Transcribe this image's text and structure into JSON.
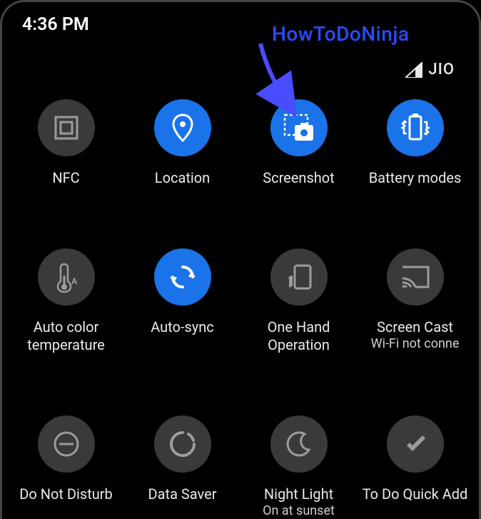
{
  "status": {
    "time": "4:36 PM",
    "carrier": "JIO"
  },
  "annotation": {
    "watermark": "HowToDoNinja"
  },
  "colors": {
    "active": "#1a73e8",
    "inactive": "#3a3a3a",
    "accent_annotation": "#2a4cff"
  },
  "tiles": [
    {
      "id": "nfc",
      "label": "NFC",
      "sublabel": "",
      "active": false,
      "icon": "nfc-icon"
    },
    {
      "id": "location",
      "label": "Location",
      "sublabel": "",
      "active": true,
      "icon": "location-icon"
    },
    {
      "id": "screenshot",
      "label": "Screenshot",
      "sublabel": "",
      "active": true,
      "icon": "screenshot-icon"
    },
    {
      "id": "battery",
      "label": "Battery modes",
      "sublabel": "",
      "active": true,
      "icon": "battery-icon"
    },
    {
      "id": "autocolor",
      "label": "Auto color temperature",
      "sublabel": "",
      "active": false,
      "icon": "thermometer-icon"
    },
    {
      "id": "autosync",
      "label": "Auto-sync",
      "sublabel": "",
      "active": true,
      "icon": "sync-icon"
    },
    {
      "id": "onehand",
      "label": "One Hand Operation",
      "sublabel": "",
      "active": false,
      "icon": "onehand-icon"
    },
    {
      "id": "screencast",
      "label": "Screen Cast",
      "sublabel": "Wi-Fi not conne",
      "active": false,
      "icon": "cast-icon"
    },
    {
      "id": "dnd",
      "label": "Do Not Disturb",
      "sublabel": "",
      "active": false,
      "icon": "dnd-icon"
    },
    {
      "id": "datasaver",
      "label": "Data Saver",
      "sublabel": "",
      "active": false,
      "icon": "datasaver-icon"
    },
    {
      "id": "nightlight",
      "label": "Night Light",
      "sublabel": "On at sunset",
      "active": false,
      "icon": "moon-icon"
    },
    {
      "id": "todoquickadd",
      "label": "To Do Quick Add",
      "sublabel": "",
      "active": false,
      "icon": "check-icon"
    }
  ]
}
